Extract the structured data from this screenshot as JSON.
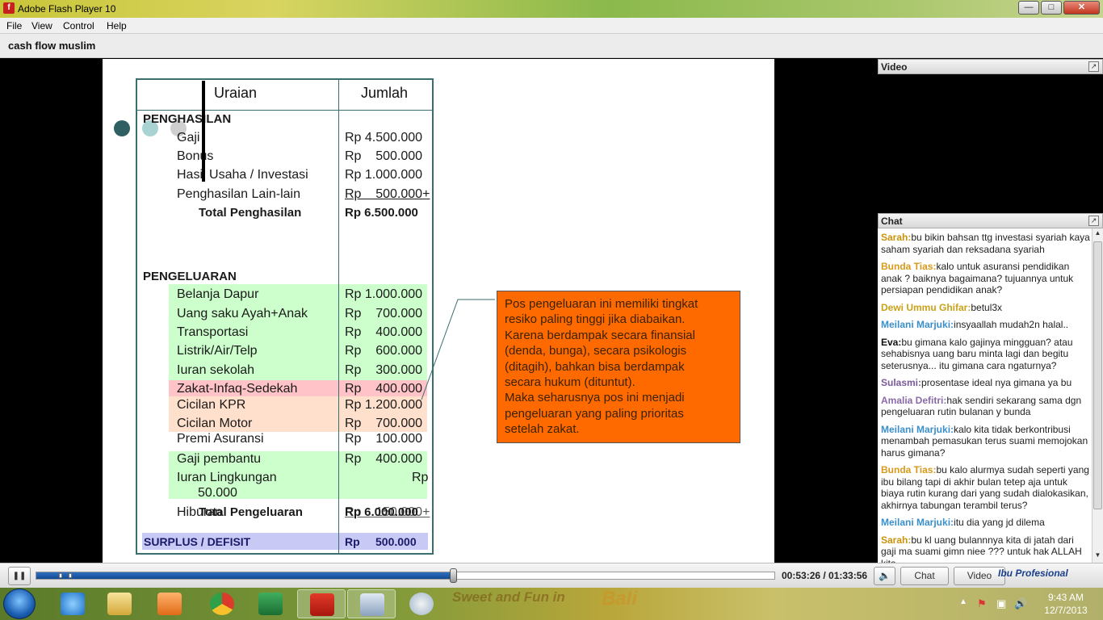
{
  "window": {
    "title": "Adobe Flash Player 10",
    "min": "—",
    "max": "□",
    "close": "✕"
  },
  "menu": [
    "File",
    "View",
    "Control",
    "Help"
  ],
  "presentation": {
    "title": "cash flow muslim"
  },
  "slide": {
    "col_uraian": "Uraian",
    "col_jumlah": "Jumlah",
    "income": {
      "heading": "PENGHASILAN",
      "items": [
        {
          "label": "Gaji",
          "amount": "Rp 4.500.000"
        },
        {
          "label": "Bonus",
          "amount": "Rp    500.000"
        },
        {
          "label": "Hasil Usaha / Investasi",
          "amount": "Rp 1.000.000"
        },
        {
          "label": "Penghasilan Lain-lain",
          "amount": "Rp    500.000+"
        }
      ],
      "total_label": "Total Penghasilan",
      "total_amount": "Rp 6.500.000"
    },
    "expense": {
      "heading": "PENGELUARAN",
      "items": [
        {
          "label": "Belanja Dapur",
          "amount": "Rp 1.000.000"
        },
        {
          "label": "Uang saku Ayah+Anak",
          "amount": "Rp    700.000"
        },
        {
          "label": "Transportasi",
          "amount": "Rp    400.000"
        },
        {
          "label": "Listrik/Air/Telp",
          "amount": "Rp    600.000"
        },
        {
          "label": "Iuran sekolah",
          "amount": "Rp    300.000"
        },
        {
          "label": "Zakat-Infaq-Sedekah",
          "amount": "Rp    400.000"
        },
        {
          "label": "Cicilan KPR",
          "amount": "Rp 1.200.000"
        },
        {
          "label": "Cicilan Motor",
          "amount": "Rp    700.000"
        },
        {
          "label": "Premi Asuransi",
          "amount": "Rp    100.000"
        },
        {
          "label": "Gaji pembantu",
          "amount": "Rp    400.000"
        },
        {
          "label": "Iuran Lingkungan",
          "amount": "Rp"
        },
        {
          "label": "50.000"
        }
      ],
      "hiburan_label": "Hiburan",
      "total_label": "Total Pengeluaran",
      "total_amount": "Rp 6.000.000",
      "total_overlap": "Rp    150.000+"
    },
    "surplus_label": "SURPLUS / DEFISIT",
    "surplus_rp": "Rp",
    "surplus_amount": "500.000",
    "callout": {
      "lines": [
        "Pos pengeluaran ini memiliki tingkat",
        "resiko paling tinggi jika diabaikan.",
        "Karena berdampak secara finansial",
        "(denda, bunga), secara psikologis",
        "(ditagih), bahkan bisa berdampak",
        "secara hukum (dituntut).",
        "Maka seharusnya pos ini menjadi",
        "pengeluaran yang paling prioritas",
        "setelah zakat."
      ]
    },
    "colors": {
      "border": "#3b6e6e",
      "green": "#ccffcc",
      "pink": "#ffc3c8",
      "peach": "#ffe0cc",
      "surplus": "#c9c9f5",
      "callout": "#ff6a00"
    }
  },
  "panels": {
    "video_label": "Video",
    "chat_label": "Chat",
    "expand_icon": "↗"
  },
  "chat": [
    {
      "who": "Sarah:",
      "color": "#c9920b",
      "text": "bu bikin bahsan ttg investasi syariah kaya saham syariah dan reksadana syariah"
    },
    {
      "who": "Bunda Tias:",
      "color": "#d79a1a",
      "text": "kalo untuk asuransi pendidikan anak ? baiknya bagaimana? tujuannya untuk persiapan pendidikan anak?"
    },
    {
      "who": "Dewi Ummu Ghifar:",
      "color": "#c9a21a",
      "text": "betul3x"
    },
    {
      "who": "Meilani Marjuki:",
      "color": "#3b8fc9",
      "text": "insyaallah mudah2n halal.."
    },
    {
      "who": "Eva:",
      "color": "#111111",
      "text": "bu gimana kalo gajinya mingguan? atau sehabisnya uang baru minta lagi dan begitu seterusnya... itu gimana cara ngaturnya?"
    },
    {
      "who": "Sulasmi:",
      "color": "#7a5a9a",
      "text": "prosentase ideal nya gimana ya bu"
    },
    {
      "who": "Amalia Defitri:",
      "color": "#8a6aa8",
      "text": "hak sendiri sekarang sama dgn pengeluaran rutin bulanan y bunda"
    },
    {
      "who": "Meilani Marjuki:",
      "color": "#3b8fc9",
      "text": "kalo kita tidak berkontribusi menambah pemasukan terus suami memojokan harus gimana?"
    },
    {
      "who": "Bunda Tias:",
      "color": "#d79a1a",
      "text": "bu kalo alurmya sudah seperti yang ibu bilang tapi di akhir bulan tetep aja untuk biaya rutin kurang dari yang sudah dialokasikan, akhirnya tabungan terambil terus?"
    },
    {
      "who": "Meilani Marjuki:",
      "color": "#3b8fc9",
      "text": "itu dia yang jd dilema"
    },
    {
      "who": "Sarah:",
      "color": "#c9920b",
      "text": "bu kl uang bulannnya kita di jatah dari gaji ma suami gimn niee ??? untuk hak ALLAH kita"
    }
  ],
  "player": {
    "pause_icon": "❚❚",
    "time": "00:53:26 / 01:33:56",
    "progress_fraction": 0.565,
    "volume_icon": "🔈",
    "chat_button": "Chat",
    "video_button": "Video",
    "brand": "Ibu Profesional"
  },
  "taskbar": {
    "time": "9:43 AM",
    "date": "12/7/2013",
    "wallpaper_text": "Sweet and Fun in",
    "wallpaper_place": "Bali",
    "tray_up": "▲",
    "tray_speaker": "🔊",
    "tray_flag": "⚑",
    "tray_net": "▣"
  }
}
